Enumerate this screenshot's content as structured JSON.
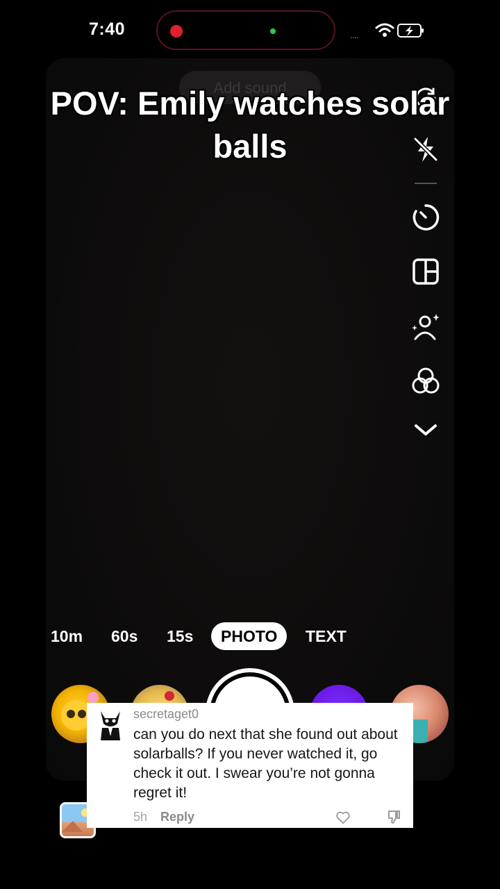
{
  "status_bar": {
    "time": "7:40",
    "signal_dots": "....",
    "icons": [
      "recording-indicator",
      "camera-in-use-indicator",
      "wifi-icon",
      "battery-charging-icon"
    ]
  },
  "camera": {
    "ghost_pill_text": "Add sound"
  },
  "overlay": {
    "title": "POV: Emily watches solar balls"
  },
  "toolbar": {
    "icons": [
      "flip-camera-icon",
      "flash-off-icon",
      "timer-icon",
      "layout-icon",
      "retouch-icon",
      "filters-icon",
      "more-chevron-icon"
    ]
  },
  "modes": {
    "items": [
      "10m",
      "60s",
      "15s",
      "PHOTO",
      "TEXT"
    ],
    "selected": "PHOTO"
  },
  "comment": {
    "username": "secretaget0",
    "text": "can you do next that she found out about solarballs? If you never watched it, go check it out. I swear you’re not gonna regret it!",
    "time": "5h",
    "reply_label": "Reply"
  },
  "colors": {
    "background": "#000000",
    "recording": "#e0202a",
    "camera_dot": "#2ecc40",
    "effect_purple": "#6a18e0"
  }
}
